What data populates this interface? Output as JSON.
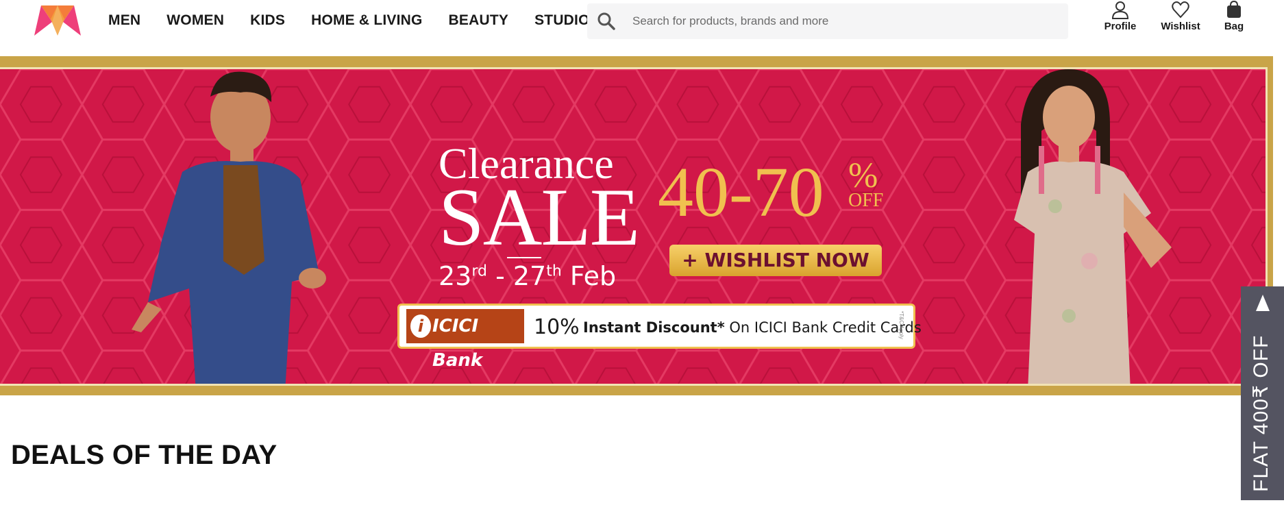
{
  "header": {
    "logo": "myntra-logo-icon",
    "nav": [
      "MEN",
      "WOMEN",
      "KIDS",
      "HOME & LIVING",
      "BEAUTY",
      "STUDIO"
    ],
    "search": {
      "placeholder": "Search for products, brands and more",
      "icon": "search-icon"
    },
    "actions": [
      {
        "label": "Profile",
        "icon": "profile-icon"
      },
      {
        "label": "Wishlist",
        "icon": "heart-icon"
      },
      {
        "label": "Bag",
        "icon": "bag-icon"
      }
    ]
  },
  "banner": {
    "clearance": "Clearance",
    "sale": "SALE",
    "dates": {
      "start_day": "23",
      "start_suffix": "rd",
      "sep": " - ",
      "end_day": "27",
      "end_suffix": "th",
      "month": " Feb"
    },
    "discount": "40-70",
    "discount_pct": "%",
    "discount_off": "OFF",
    "cta": "+ WISHLIST NOW",
    "bank": {
      "name": "ICICI Bank",
      "logo_letter": "i",
      "percent": "10%",
      "text_bold": "Instant Discount*",
      "text_rest": " On ICICI Bank Credit Cards",
      "tc": "*T&C Apply"
    },
    "colors": {
      "background": "#d11848",
      "gold": "#f0c04f",
      "border": "#c9a448"
    }
  },
  "deals": {
    "title": "DEALS OF THE DAY"
  },
  "side_offer": {
    "text": "FLAT 400₹ OFF",
    "icon": "caret-up-icon"
  }
}
